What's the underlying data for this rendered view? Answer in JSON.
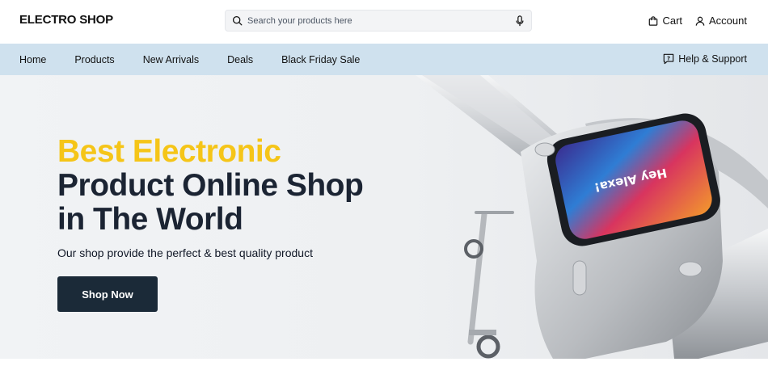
{
  "header": {
    "logo": "ELECTRO SHOP",
    "search": {
      "placeholder": "Search your products here",
      "icon": "search-icon",
      "mic_icon": "microphone-icon"
    },
    "actions": [
      {
        "label": "Cart",
        "icon": "shopping-bag-icon"
      },
      {
        "label": "Account",
        "icon": "user-icon"
      }
    ]
  },
  "nav": {
    "items": [
      {
        "label": "Home"
      },
      {
        "label": "Products"
      },
      {
        "label": "New Arrivals"
      },
      {
        "label": "Deals"
      },
      {
        "label": "Black Friday Sale"
      }
    ],
    "help": {
      "label": "Help & Support",
      "icon": "help-chat-icon"
    }
  },
  "hero": {
    "headline_accent": "Best Electronic",
    "headline_line2": "Product Online Shop",
    "headline_line3": "in The World",
    "subtitle": "Our shop provide  the perfect & best quality product",
    "cta_label": "Shop Now",
    "screen_text": "Hey Alexa!",
    "colors": {
      "accent": "#f5c518",
      "dark": "#1b2433",
      "nav_bg": "#cfe1ee",
      "button": "#1b2a38"
    }
  }
}
